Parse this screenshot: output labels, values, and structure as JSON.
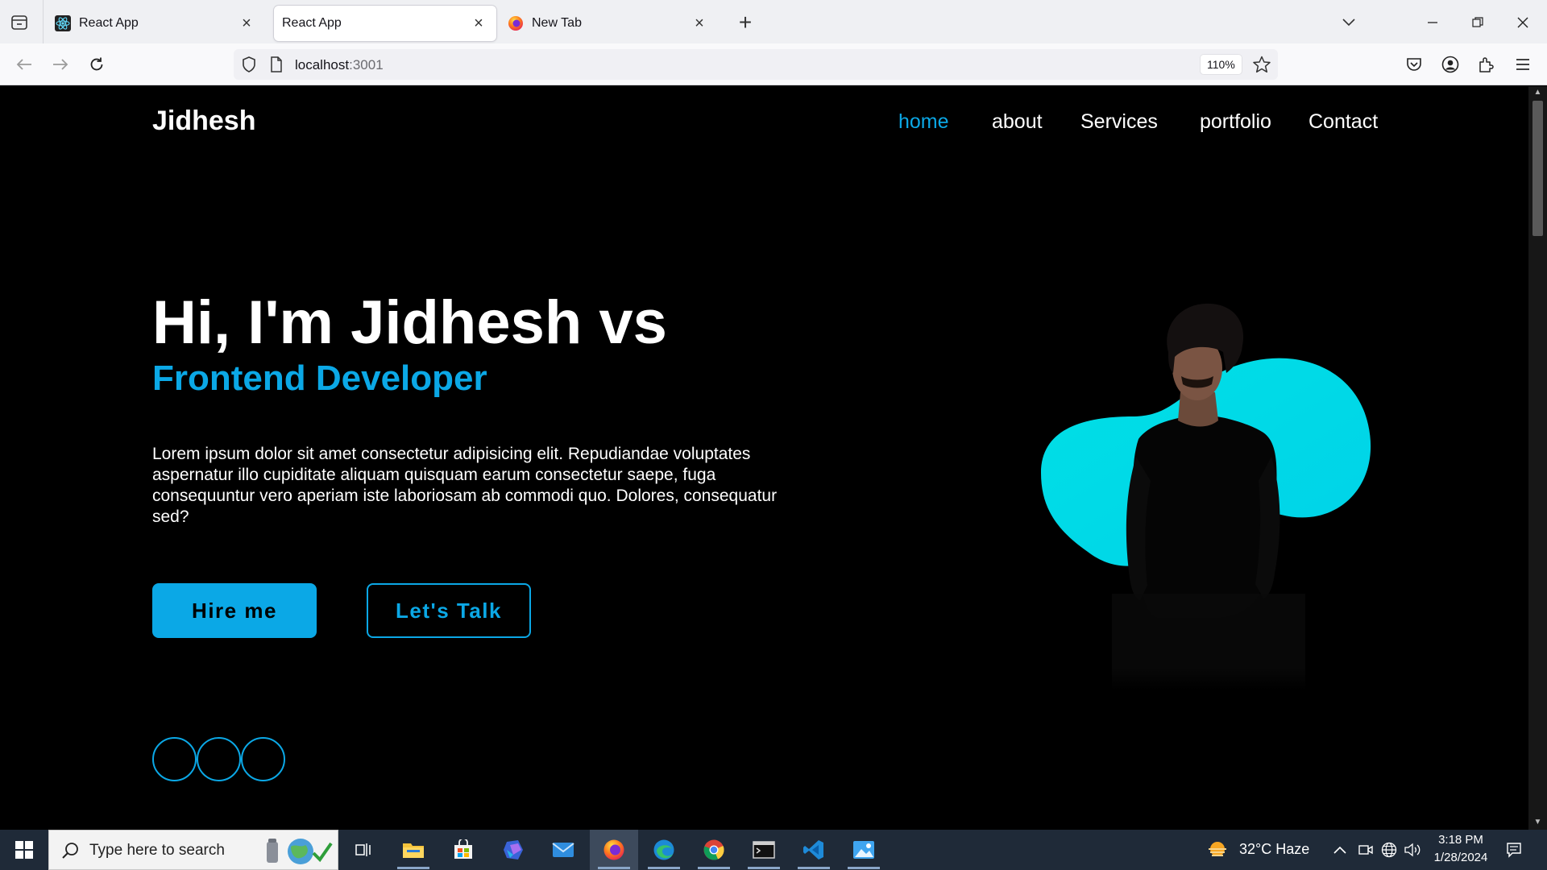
{
  "browser": {
    "tabs": [
      {
        "label": "React App",
        "icon": "react-icon",
        "active": false
      },
      {
        "label": "React App",
        "icon": "",
        "active": true
      },
      {
        "label": "New Tab",
        "icon": "firefox-icon",
        "active": false
      }
    ],
    "url_host": "localhost",
    "url_port": ":3001",
    "zoom": "110%"
  },
  "site": {
    "logo": "Jidhesh",
    "nav": [
      {
        "label": "home",
        "active": true
      },
      {
        "label": "about",
        "active": false
      },
      {
        "label": "Services",
        "active": false
      },
      {
        "label": "portfolio",
        "active": false
      },
      {
        "label": "Contact",
        "active": false
      }
    ],
    "hero": {
      "title": "Hi, I'm Jidhesh vs",
      "subtitle": "Frontend Developer",
      "description": "Lorem ipsum dolor sit amet consectetur adipisicing elit. Repudiandae voluptates aspernatur illo cupiditate aliquam quisquam earum consectetur saepe, fuga consequuntur vero aperiam iste laboriosam ab commodi quo. Dolores, consequatur sed?",
      "hire_label": "Hire me",
      "talk_label": "Let's Talk"
    },
    "social_count": 3,
    "accent_color": "#0ba8e6",
    "blob_color": "#00dde8"
  },
  "taskbar": {
    "search_placeholder": "Type here to search",
    "apps": [
      "task-view-icon",
      "file-explorer-icon",
      "microsoft-store-icon",
      "copilot-icon",
      "mail-icon",
      "firefox-icon",
      "edge-icon",
      "chrome-icon",
      "terminal-icon",
      "vscode-icon",
      "photos-icon"
    ],
    "weather": "32°C  Haze",
    "time": "3:18 PM",
    "date": "1/28/2024"
  }
}
